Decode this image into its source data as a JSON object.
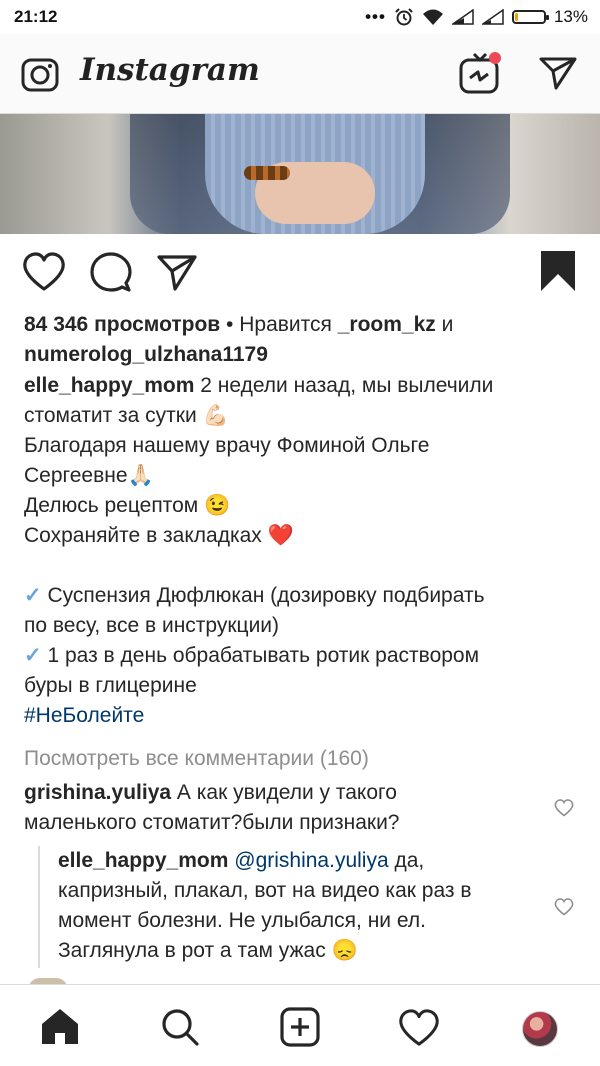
{
  "status": {
    "time": "21:12",
    "battery": "13%",
    "battery_level": 0.13
  },
  "header": {
    "app_title": "Instagram"
  },
  "post": {
    "views": "84 346 просмотров",
    "likes_prefix": " • Нравится ",
    "liker1": "_room_kz",
    "likes_and": " и",
    "liker2": "numerolog_ulzhana1179",
    "author": "elle_happy_mom",
    "caption_first": " 2 недели назад, мы вылечили",
    "caption_line2": "стоматит за сутки 💪🏻",
    "caption_line3": "Благодаря нашему врачу Фоминой Ольге",
    "caption_line4": "Сергеевне🙏🏻",
    "caption_line5": "Делюсь рецептом 😉",
    "caption_line6": "Сохраняйте в закладках ❤️",
    "check_mark": "✓",
    "tip1_line1": " Суспензия Дюфлюкан (дозировку подбирать",
    "tip1_line2": "по весу, все в инструкции)",
    "tip2_line1": "  1 раз в день обрабатывать ротик раствором",
    "tip2_line2": "буры в глицерине",
    "hashtag": "#НеБолейте",
    "view_all_comments": "Посмотреть все комментарии (160)"
  },
  "comments": [
    {
      "user": "grishina.yuliya",
      "text_line1": " А как увидели у такого",
      "text_line2": "маленького стоматит?были признаки?"
    }
  ],
  "reply": {
    "user": "elle_happy_mom",
    "mention": "@grishina.yuliya",
    "text_line1": " да,",
    "text_line2": "капризный, плакал, вот на видео как раз в",
    "text_line3": "момент болезни. Не улыбался, ни ел.",
    "text_line4": "Заглянула в рот а там ужас 😞"
  },
  "colors": {
    "link": "#00376b",
    "grey": "#8e8e8e",
    "notification_dot": "#ed4956"
  }
}
